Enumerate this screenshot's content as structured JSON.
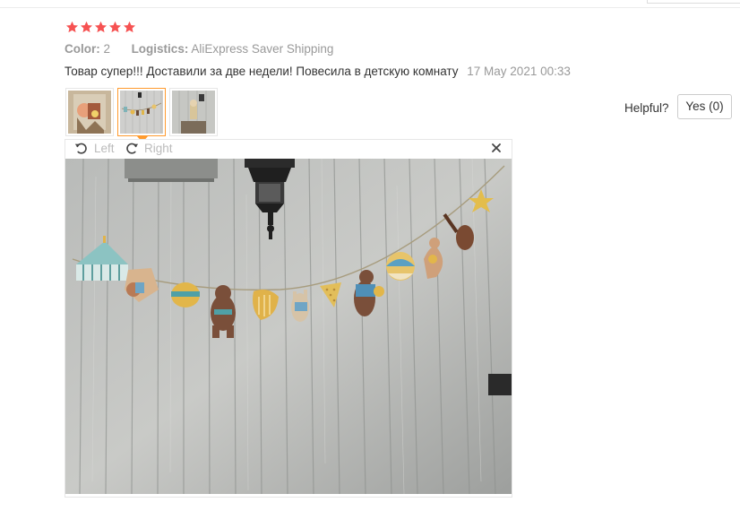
{
  "review": {
    "rating": 5,
    "stars": [
      "★",
      "★",
      "★",
      "★",
      "★"
    ],
    "color_label": "Color:",
    "color_value": "2",
    "logistics_label": "Logistics:",
    "logistics_value": "AliExpress Saver Shipping",
    "text": "Товар супер!!! Доставили за две недели! Повесила в детскую комнату",
    "date": "17 May 2021 00:33"
  },
  "helpful": {
    "label": "Helpful?",
    "yes_label": "Yes (0)"
  },
  "viewer": {
    "rotate_left_label": "Left",
    "rotate_right_label": "Right",
    "selected_thumbnail": 2,
    "thumbnail_count": 3
  },
  "icons": {
    "star": "star-icon",
    "rotate_left": "rotate-left-icon",
    "rotate_right": "rotate-right-icon",
    "close": "close-icon"
  },
  "colors": {
    "star": "#f65252",
    "active_thumb_border": "#ff9b2e",
    "muted_text": "#999999",
    "toolbar_text": "#bbbbbb"
  }
}
